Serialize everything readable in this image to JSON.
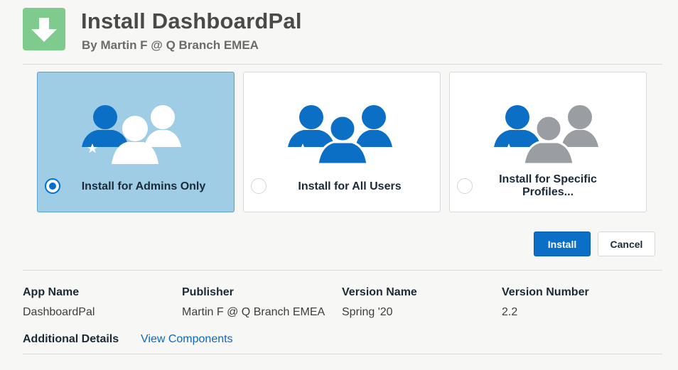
{
  "header": {
    "title": "Install DashboardPal",
    "subtitle": "By Martin F @ Q Branch EMEA",
    "icon": "download-icon"
  },
  "install_options": [
    {
      "label": "Install for Admins Only",
      "selected": true,
      "icon": "admin-users-icon"
    },
    {
      "label": "Install for All Users",
      "selected": false,
      "icon": "all-users-icon"
    },
    {
      "label": "Install for Specific Profiles...",
      "selected": false,
      "icon": "specific-profiles-icon"
    }
  ],
  "actions": {
    "install_label": "Install",
    "cancel_label": "Cancel"
  },
  "details": {
    "columns": [
      {
        "label": "App Name",
        "value": "DashboardPal"
      },
      {
        "label": "Publisher",
        "value": "Martin F @ Q Branch EMEA"
      },
      {
        "label": "Version Name",
        "value": "Spring '20"
      },
      {
        "label": "Version Number",
        "value": "2.2"
      }
    ],
    "additional_label": "Additional Details",
    "view_components_label": "View Components"
  },
  "colors": {
    "accent": "#0070d2",
    "selected_bg": "#9ecde5",
    "app_icon_bg": "#7ecb8d",
    "person_blue": "#0b6fc6",
    "person_grey": "#9a9ea3"
  }
}
